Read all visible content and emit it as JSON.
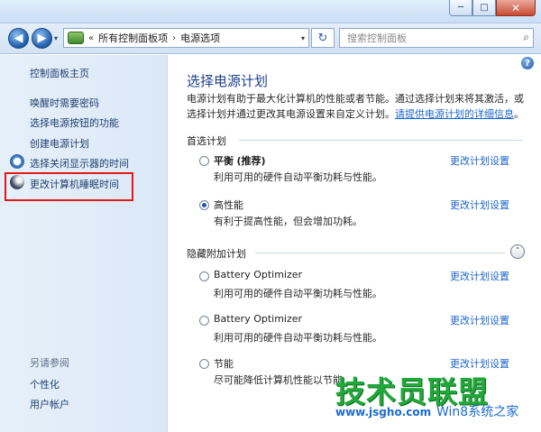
{
  "titlebar": {
    "minimize": "─",
    "maximize": "□",
    "close": "✕"
  },
  "nav": {
    "back": "◀",
    "forward": "▶",
    "history": "▾",
    "breadcrumb_sep1": "«",
    "breadcrumb_root": "所有控制面板项",
    "breadcrumb_sep2": "›",
    "breadcrumb_current": "电源选项",
    "address_drop": "▾",
    "refresh": "↻",
    "search_placeholder": "搜索控制面板",
    "search_icon": "⌕"
  },
  "sidebar": {
    "home": "控制面板主页",
    "items": [
      "唤醒时需要密码",
      "选择电源按钮的功能",
      "创建电源计划",
      "选择关闭显示器的时间",
      "更改计算机睡眠时间"
    ],
    "see_also_heading": "另请参阅",
    "see_also": [
      "个性化",
      "用户帐户"
    ],
    "icons": [
      "clock-icon",
      "moon-icon"
    ]
  },
  "main": {
    "help": "?",
    "title": "选择电源计划",
    "desc_line1": "电源计划有助于最大化计算机的性能或者节能。通过选择计划来将其激活，或",
    "desc_line2": "选择计划并通过更改其电源设置来自定义计划。",
    "desc_link": "请提供电源计划的详细信息",
    "desc_end": "。",
    "preferred_heading": "首选计划",
    "hidden_heading": "隐藏附加计划",
    "collapse_icon": "˄",
    "change_link": "更改计划设置",
    "plans": [
      {
        "name": "平衡",
        "tag": "(推荐)",
        "desc": "利用可用的硬件自动平衡功耗与性能。",
        "selected": false
      },
      {
        "name": "高性能",
        "tag": "",
        "desc": "有利于提高性能，但会增加功耗。",
        "selected": true
      },
      {
        "name": "Battery Optimizer",
        "tag": "",
        "desc": "利用可用的硬件自动平衡功耗与性能。",
        "selected": false
      },
      {
        "name": "Battery Optimizer",
        "tag": "",
        "desc": "利用可用的硬件自动平衡功耗与性能。",
        "selected": false
      },
      {
        "name": "节能",
        "tag": "",
        "desc": "尽可能降低计算机性能以节能",
        "selected": false
      }
    ]
  },
  "watermark": {
    "main": "技术员联盟",
    "win": "Win8系统之家",
    "url": "www.jsgho.com"
  },
  "colors": {
    "link": "#1d66cc",
    "title": "#1e3f8a",
    "highlight": "#e21a1a",
    "watermark_green": "#22a83a"
  }
}
